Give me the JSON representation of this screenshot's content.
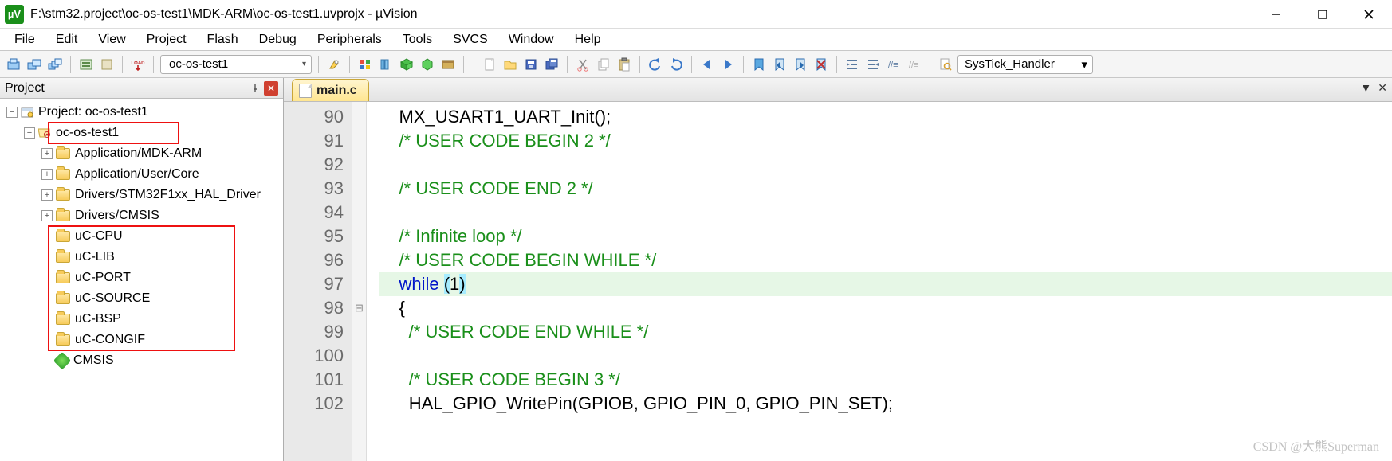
{
  "window": {
    "title": "F:\\stm32.project\\oc-os-test1\\MDK-ARM\\oc-os-test1.uvprojx - µVision",
    "app_icon_label": "µV"
  },
  "menu": [
    "File",
    "Edit",
    "View",
    "Project",
    "Flash",
    "Debug",
    "Peripherals",
    "Tools",
    "SVCS",
    "Window",
    "Help"
  ],
  "toolbar": {
    "target": "oc-os-test1",
    "load_label": "LOAD",
    "search_symbol": "SysTick_Handler"
  },
  "project_panel": {
    "title": "Project",
    "root_label": "Project: oc-os-test1",
    "target_label": "oc-os-test1",
    "groups_top": [
      "Application/MDK-ARM",
      "Application/User/Core",
      "Drivers/STM32F1xx_HAL_Driver",
      "Drivers/CMSIS"
    ],
    "groups_red": [
      "uC-CPU",
      "uC-LIB",
      "uC-PORT",
      "uC-SOURCE",
      "uC-BSP",
      "uC-CONGIF"
    ],
    "cmsis_label": "CMSIS"
  },
  "editor": {
    "tab_label": "main.c",
    "lines": [
      {
        "num": 90,
        "kind": "call",
        "text_prefix": "    ",
        "func": "MX_USART1_UART_Init",
        "after": "();"
      },
      {
        "num": 91,
        "kind": "comment",
        "text": "    /* USER CODE BEGIN 2 */"
      },
      {
        "num": 92,
        "kind": "blank",
        "text": ""
      },
      {
        "num": 93,
        "kind": "comment",
        "text": "    /* USER CODE END 2 */"
      },
      {
        "num": 94,
        "kind": "blank",
        "text": ""
      },
      {
        "num": 95,
        "kind": "comment",
        "text": "    /* Infinite loop */"
      },
      {
        "num": 96,
        "kind": "comment",
        "text": "    /* USER CODE BEGIN WHILE */"
      },
      {
        "num": 97,
        "kind": "while",
        "prefix": "    ",
        "kw": "while",
        "mid": " ",
        "open": "(",
        "arg": "1",
        "close": ")",
        "hl": true
      },
      {
        "num": 98,
        "kind": "plain",
        "text": "    {",
        "fold": true
      },
      {
        "num": 99,
        "kind": "comment",
        "text": "      /* USER CODE END WHILE */"
      },
      {
        "num": 100,
        "kind": "blank",
        "text": ""
      },
      {
        "num": 101,
        "kind": "comment",
        "text": "      /* USER CODE BEGIN 3 */"
      },
      {
        "num": 102,
        "kind": "callpart",
        "text_prefix": "      ",
        "func": "HAL_GPIO_WritePin",
        "after": "(GPIOB, GPIO_PIN_0, GPIO_PIN_SET);"
      }
    ]
  },
  "watermark": "CSDN @大熊Superman"
}
